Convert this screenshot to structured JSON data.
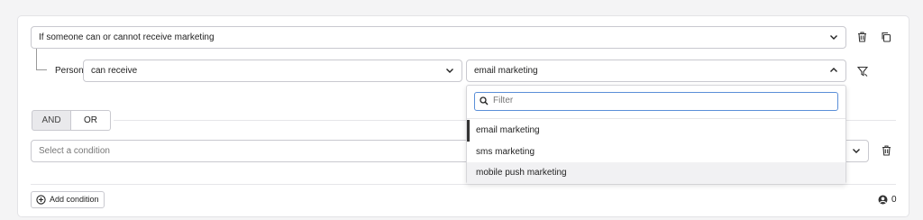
{
  "group": {
    "condition_select": "If someone can or cannot receive marketing",
    "person_label": "Person",
    "operator_select": "can receive",
    "value_select": "email marketing"
  },
  "logic": {
    "and_label": "AND",
    "or_label": "OR"
  },
  "second_condition": {
    "placeholder": "Select a condition"
  },
  "dropdown": {
    "filter_placeholder": "Filter",
    "options": [
      "email marketing",
      "sms marketing",
      "mobile push marketing"
    ]
  },
  "footer": {
    "add_label": "Add condition",
    "count": "0"
  },
  "colors": {
    "accent": "#5b8fd8",
    "selected_bar": "#333333"
  }
}
